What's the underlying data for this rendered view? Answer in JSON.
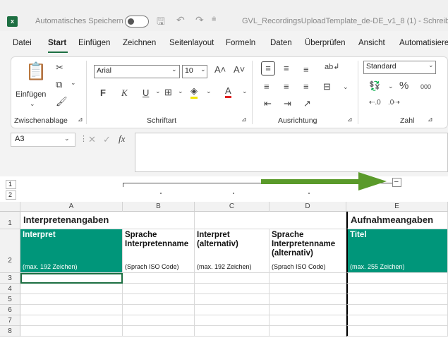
{
  "titlebar": {
    "logo": "x",
    "autosave_label": "Automatisches Speichern",
    "filename": "GVL_RecordingsUploadTemplate_de-DE_v1_8 (1)  -  Schreibges..."
  },
  "menu": {
    "items": [
      "Datei",
      "Start",
      "Einfügen",
      "Zeichnen",
      "Seitenlayout",
      "Formeln",
      "Daten",
      "Überprüfen",
      "Ansicht",
      "Automatisiere"
    ],
    "active": "Start"
  },
  "ribbon": {
    "clipboard": {
      "label": "Zwischenablage",
      "paste": "Einfügen"
    },
    "font": {
      "label": "Schriftart",
      "font_name": "Arial",
      "font_size": "10",
      "bold": "F",
      "italic": "K",
      "underline": "U"
    },
    "alignment": {
      "label": "Ausrichtung"
    },
    "number": {
      "label": "Zahl",
      "format": "Standard",
      "percent": "%",
      "thousands": "000"
    }
  },
  "formula_bar": {
    "cell_ref": "A3",
    "fx": "fx",
    "content": ""
  },
  "outline": {
    "levels": [
      "1",
      "2"
    ],
    "collapse": "–"
  },
  "sheet": {
    "columns": [
      "A",
      "B",
      "C",
      "D",
      "E"
    ],
    "rows": [
      "1",
      "2",
      "3",
      "4",
      "5",
      "6",
      "7",
      "8"
    ],
    "section_interpreten": "Interpretenangaben",
    "section_aufnahme": "Aufnahmeangaben",
    "headers": [
      {
        "title": "Interpret",
        "hint": "(max. 192 Zeichen)"
      },
      {
        "title": "Sprache Interpretenname",
        "hint": "(Sprach ISO Code)"
      },
      {
        "title": "Interpret (alternativ)",
        "hint": "(max. 192 Zeichen)"
      },
      {
        "title": "Sprache Interpretenname (alternativ)",
        "hint": "(Sprach ISO Code)"
      },
      {
        "title": "Titel",
        "hint": "(max. 255 Zeichen)"
      }
    ]
  },
  "colors": {
    "excel_green": "#1d6f42",
    "header_teal": "#00967a",
    "arrow_green": "#5a9a2a"
  }
}
